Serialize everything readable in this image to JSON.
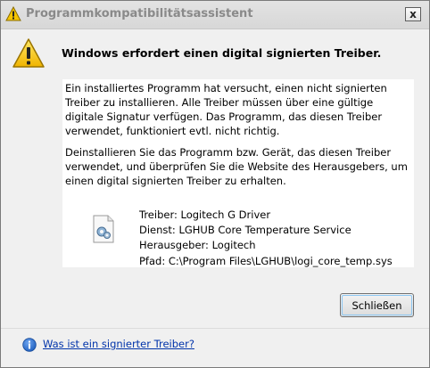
{
  "window": {
    "title": "Programmkompatibilitätsassistent",
    "close_glyph": "x"
  },
  "header": {
    "icon": "warning-icon",
    "text": "Windows erfordert einen digital signierten Treiber."
  },
  "message": {
    "paragraph1": "Ein installiertes Programm hat versucht, einen nicht signierten Treiber zu installieren. Alle Treiber müssen über eine gültige digitale Signatur verfügen. Das Programm, das diesen Treiber verwendet, funktioniert evtl. nicht richtig.",
    "paragraph2": "Deinstallieren Sie das Programm bzw. Gerät, das diesen Treiber verwendet, und überprüfen Sie die Website des Herausgebers, um einen digital signierten Treiber zu erhalten."
  },
  "driver": {
    "icon": "system-file-icon",
    "lines": [
      "Treiber: Logitech G Driver",
      "Dienst: LGHUB Core Temperature Service",
      "Herausgeber: Logitech",
      "Pfad: C:\\Program Files\\LGHUB\\logi_core_temp.sys"
    ]
  },
  "buttons": {
    "close": "Schließen"
  },
  "footer": {
    "icon": "info-icon",
    "link": "Was ist ein signierter Treiber?"
  },
  "colors": {
    "title_text": "#8a8a8a",
    "link": "#0033aa",
    "warning_fill": "#f5c400",
    "info_fill": "#1f5fbf"
  }
}
